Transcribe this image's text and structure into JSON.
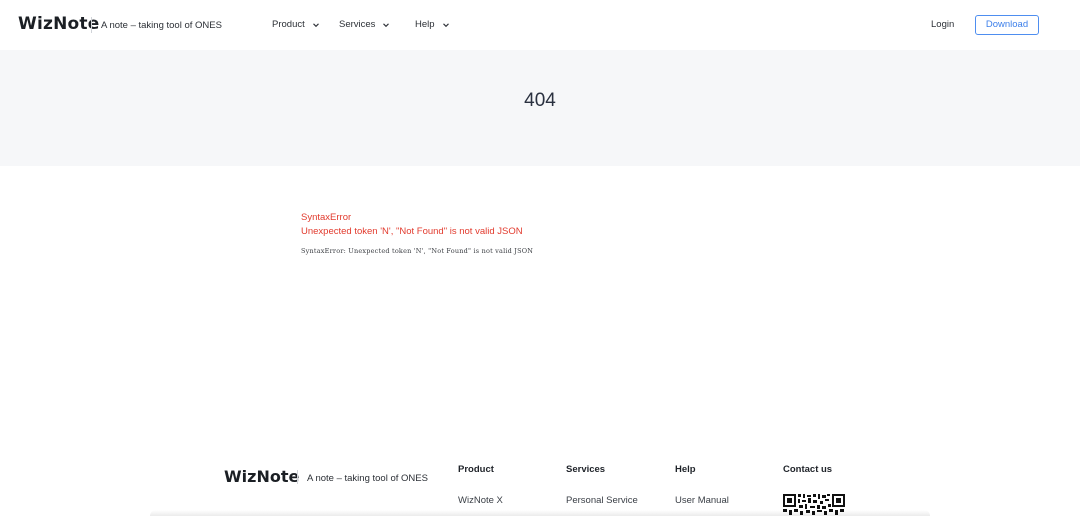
{
  "header": {
    "logo": "WizNote",
    "tagline": "A note – taking tool of ONES",
    "nav": [
      {
        "label": "Product"
      },
      {
        "label": "Services"
      },
      {
        "label": "Help"
      }
    ],
    "login_label": "Login",
    "download_label": "Download"
  },
  "hero": {
    "code": "404"
  },
  "error": {
    "title": "SyntaxError",
    "message": "Unexpected token 'N', \"Not Found\" is not valid JSON",
    "stack": "SyntaxError: Unexpected token 'N', \"Not Found\" is not valid JSON"
  },
  "footer": {
    "logo": "WizNote",
    "tagline": "A note – taking tool of ONES",
    "columns": [
      {
        "title": "Product",
        "first_link": "WizNote X"
      },
      {
        "title": "Services",
        "first_link": "Personal Service"
      },
      {
        "title": "Help",
        "first_link": "User Manual"
      },
      {
        "title": "Contact us"
      }
    ]
  },
  "icons": {
    "nav_chevron": "chevron-down-icon",
    "contact_qr": "qr-code-icon"
  },
  "colors": {
    "accent": "#3c7fea",
    "error": "#e23b2e",
    "hero_bg": "#f6f7f9"
  }
}
